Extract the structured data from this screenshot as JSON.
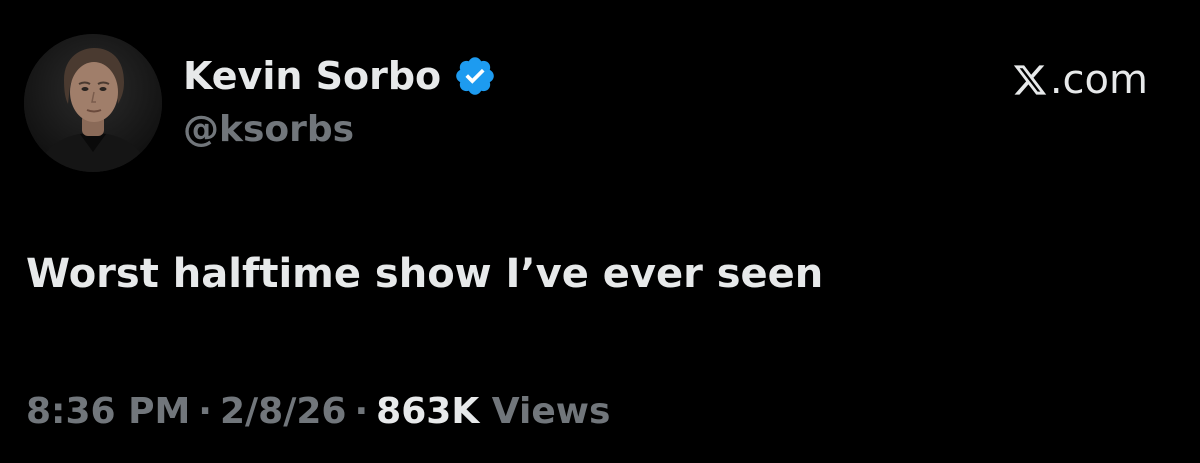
{
  "brand": {
    "text": ".com",
    "icon": "x-logo-icon"
  },
  "author": {
    "display_name": "Kevin Sorbo",
    "handle": "@ksorbs",
    "verified": true,
    "verified_icon": "verified-badge-icon",
    "verified_color": "#1d9bf0"
  },
  "tweet": {
    "text": "Worst halftime show I’ve ever seen"
  },
  "meta": {
    "time": "8:36 PM",
    "separator": "·",
    "date": "2/8/26",
    "views_count": "863K",
    "views_label": "Views"
  },
  "colors": {
    "background": "#000000",
    "primary_text": "#e7e9ea",
    "secondary_text": "#71767b"
  }
}
